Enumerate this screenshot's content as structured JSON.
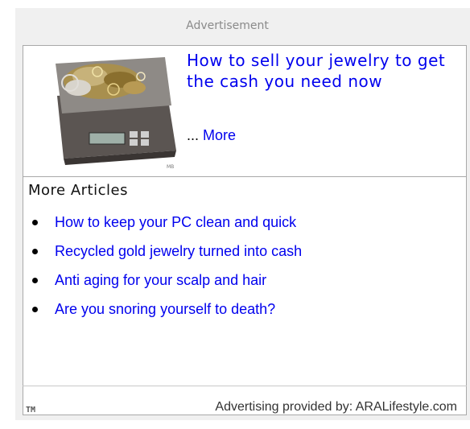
{
  "advertisement_label": "Advertisement",
  "feature": {
    "headline": "How to sell your jewelry to get the cash you need now",
    "more_prefix": "... ",
    "more_link": "More",
    "image_caption": "MB"
  },
  "more_articles": {
    "heading": "More Articles",
    "items": [
      "How to keep your PC clean and quick",
      "Recycled gold jewelry turned into cash",
      "Anti aging for your scalp and hair",
      "Are you snoring yourself to death?"
    ]
  },
  "footer": {
    "trademark": "TM",
    "provided_by": "Advertising provided by: ARALifestyle.com"
  },
  "colors": {
    "link": "#0000ee",
    "frame_bg": "#f0f0f0",
    "border": "#a9a9a9"
  }
}
